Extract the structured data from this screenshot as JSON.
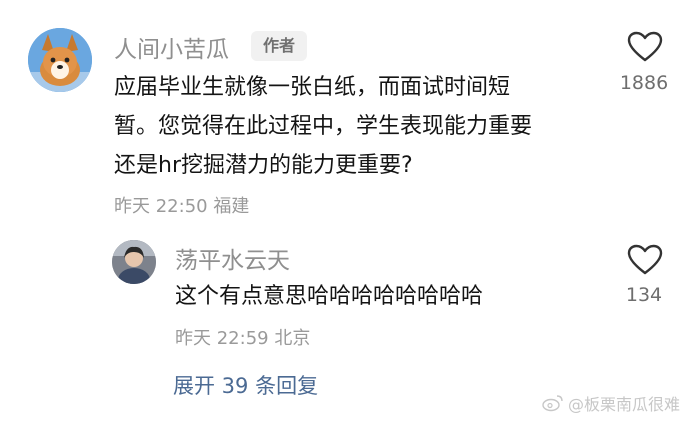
{
  "comment": {
    "username": "人间小苦瓜",
    "author_badge": "作者",
    "text": "应届毕业生就像一张白纸，而面试时间短\n暂。您觉得在此过程中，学生表现能力重要\n还是hr挖掘潜力的能力更重要?",
    "time": "昨天 22:50 福建",
    "like_count": "1886",
    "avatar_icon": "corgi-dog-avatar",
    "like_icon": "heart-outline-icon"
  },
  "reply": {
    "username": "荡平水云天",
    "text": "这个有点意思哈哈哈哈哈哈哈哈",
    "time": "昨天 22:59 北京",
    "like_count": "134",
    "avatar_icon": "person-avatar",
    "like_icon": "heart-outline-icon"
  },
  "expand_replies_label": "展开 39 条回复",
  "watermark": {
    "text": "@板栗南瓜很难",
    "icon": "weibo-logo-icon"
  },
  "colors": {
    "name": "#8f8f8f",
    "text": "#141414",
    "meta": "#9a9a9a",
    "link": "#4b6a93",
    "badge_bg": "#f1f1f1"
  }
}
